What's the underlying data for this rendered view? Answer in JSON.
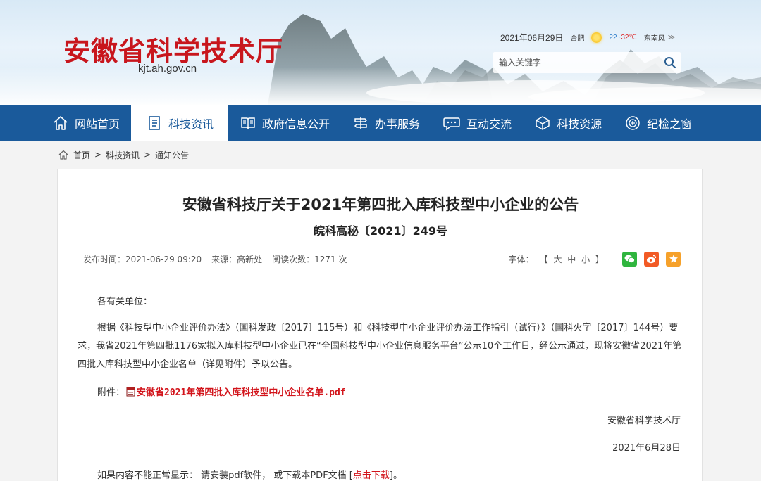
{
  "header": {
    "site_title": "安徽省科学技术厅",
    "site_domain": "kjt.ah.gov.cn",
    "date": "2021年06月29日",
    "city": "合肥",
    "temp_low": "22~",
    "temp_high": "32℃",
    "wind": "东南风",
    "wind_arrow": "≫",
    "search_placeholder": "输入关键字"
  },
  "nav": {
    "items": [
      {
        "label": "网站首页",
        "icon": "home-icon"
      },
      {
        "label": "科技资讯",
        "icon": "document-icon",
        "active": true
      },
      {
        "label": "政府信息公开",
        "icon": "book-icon"
      },
      {
        "label": "办事服务",
        "icon": "service-icon"
      },
      {
        "label": "互动交流",
        "icon": "chat-icon"
      },
      {
        "label": "科技资源",
        "icon": "cube-icon"
      },
      {
        "label": "纪检之窗",
        "icon": "shield-icon"
      }
    ]
  },
  "breadcrumb": {
    "items": [
      "首页",
      "科技资讯",
      "通知公告"
    ],
    "separator": ">"
  },
  "article": {
    "title": "安徽省科技厅关于2021年第四批入库科技型中小企业的公告",
    "subtitle": "皖科高秘〔2021〕249号",
    "publish_time": "发布时间：2021-06-29 09:20",
    "source": "来源：高新处",
    "views": "阅读次数：1271 次",
    "font_label": "字体：",
    "font_open": "【",
    "font_sizes": [
      "大",
      "中",
      "小"
    ],
    "font_close": "】",
    "salutation": "各有关单位：",
    "paragraph": "根据《科技型中小企业评价办法》（国科发政〔2017〕115号）和《科技型中小企业评价办法工作指引（试行）》（国科火字〔2017〕144号）要求，我省2021年第四批1176家拟入库科技型中小企业已在“全国科技型中小企业信息服务平台”公示10个工作日，经公示通过，现将安徽省2021年第四批入库科技型中小企业名单（详见附件）予以公告。",
    "attachment_label": "附件：",
    "attachment_name": "安徽省2021年第四批入库科技型中小企业名单.pdf",
    "signature": "安徽省科学技术厅",
    "sign_date": "2021年6月28日",
    "notice_prefix": "如果内容不能正常显示：  请安装pdf软件，  或下载本PDF文档 [",
    "notice_link": "点击下载",
    "notice_suffix": "]。"
  },
  "colors": {
    "brand_red": "#c8161d",
    "nav_blue": "#1a5a9b",
    "link_red": "#d2141b"
  }
}
